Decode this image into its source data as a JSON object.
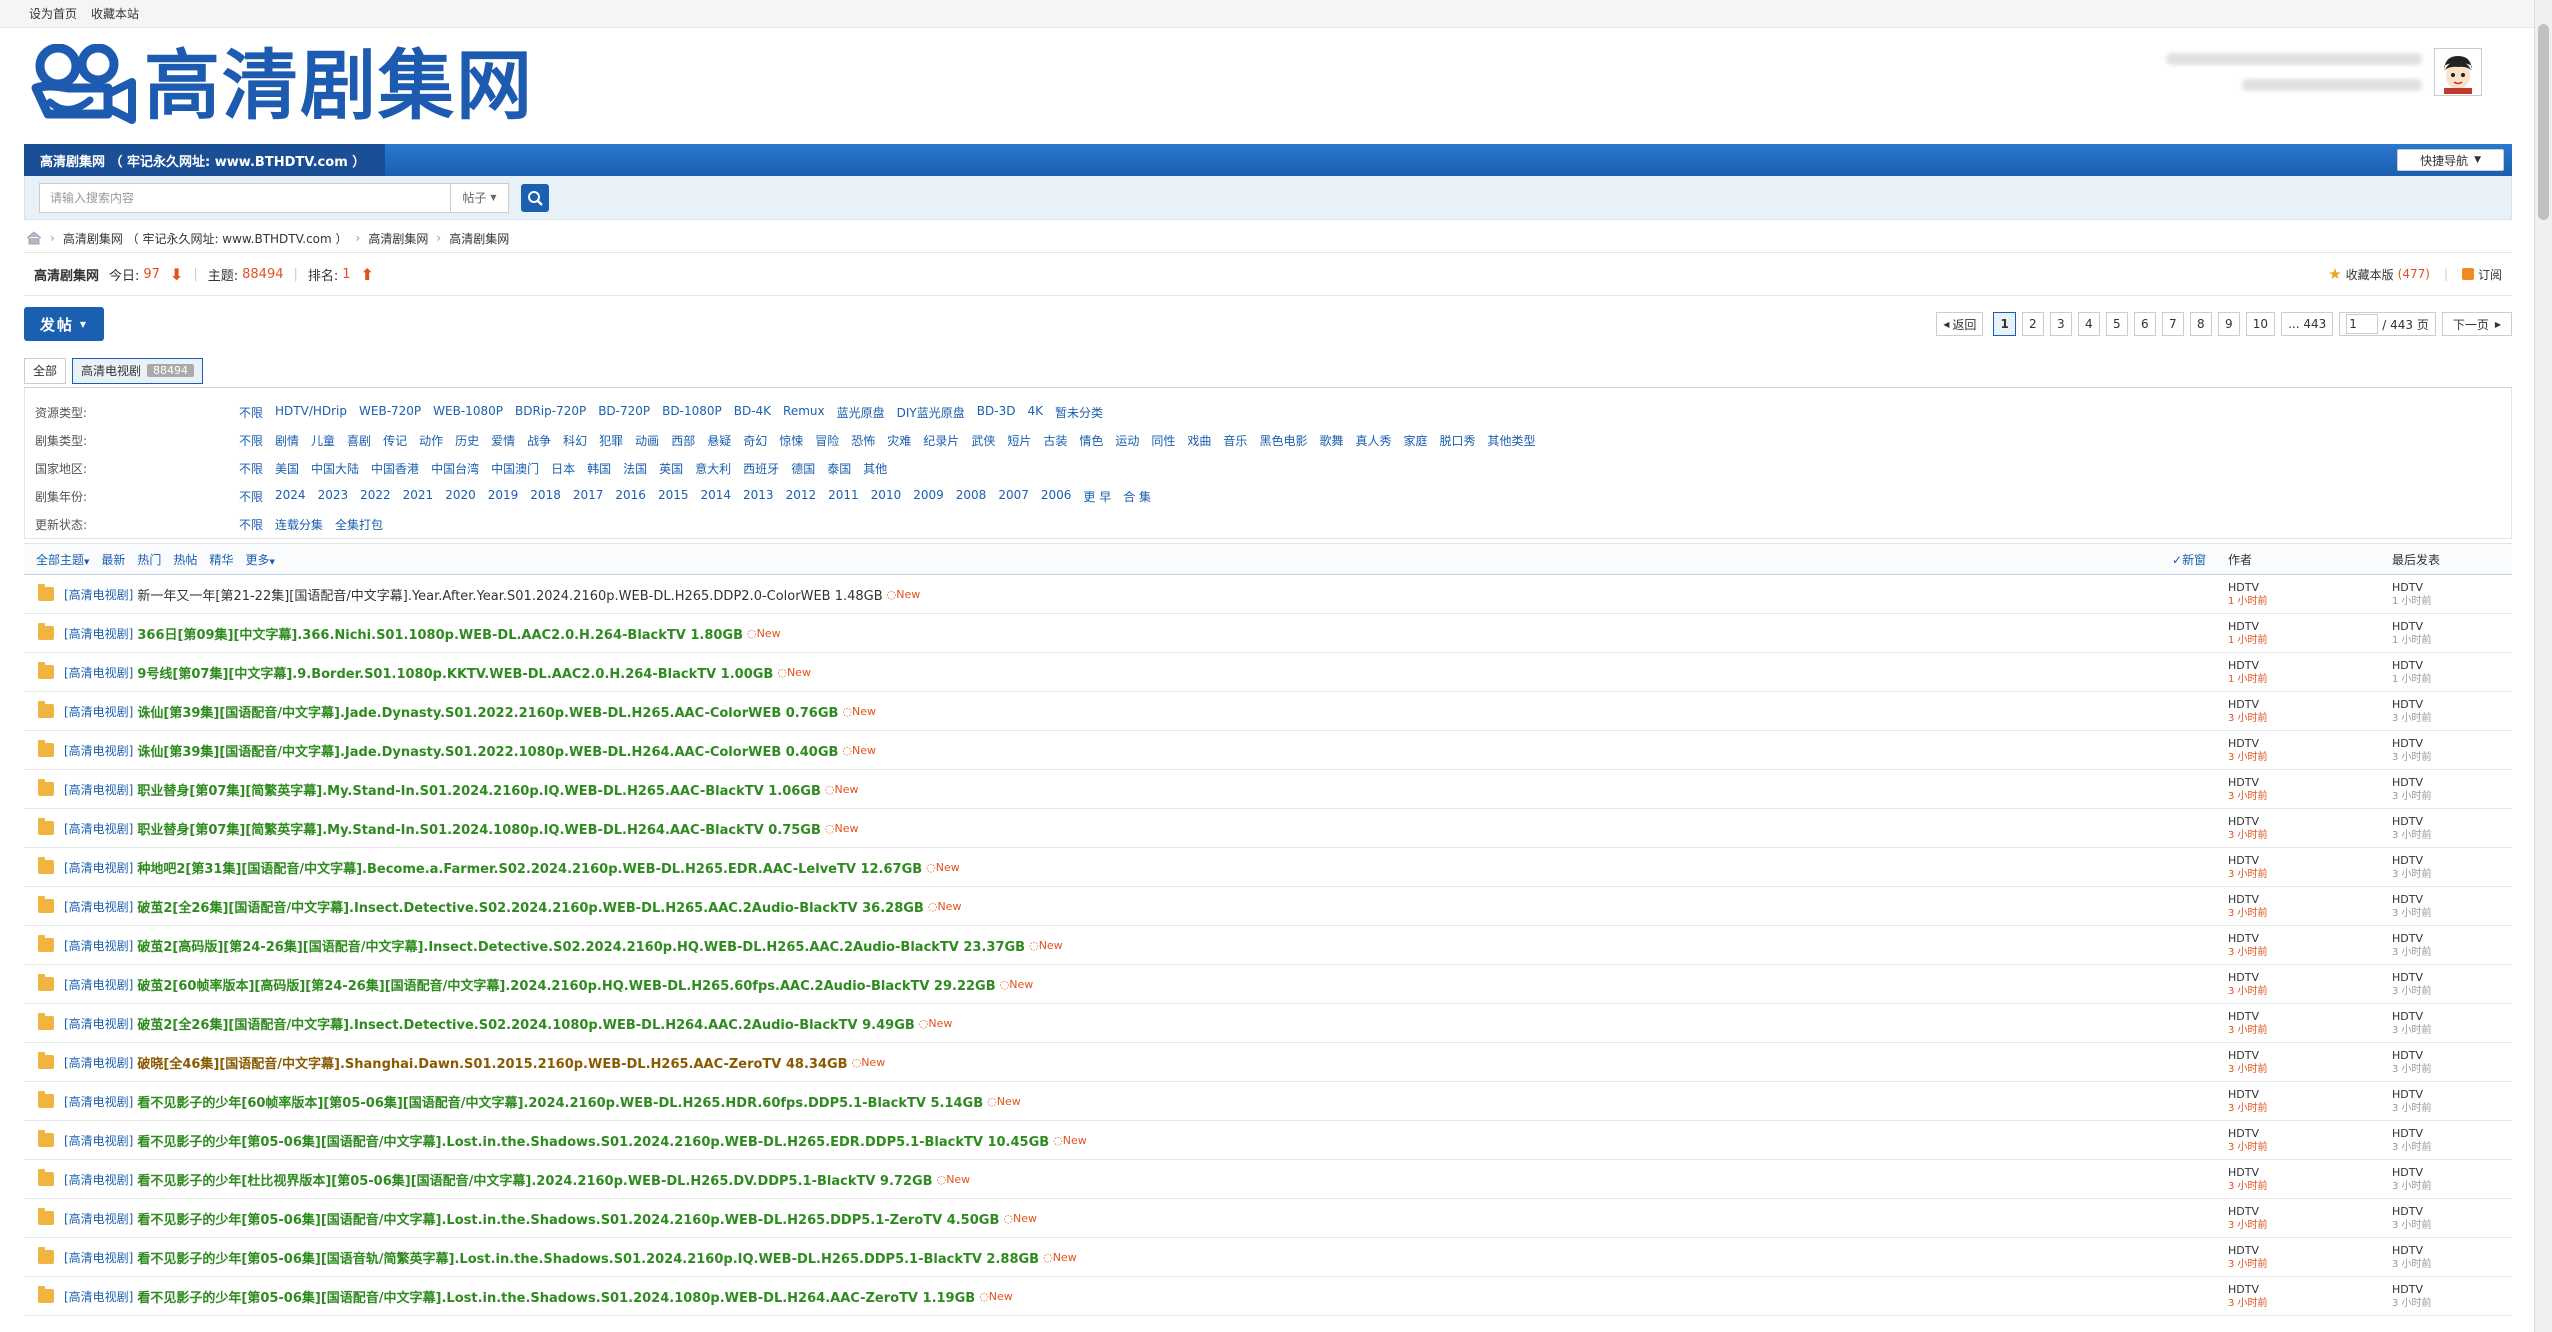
{
  "topbar": {
    "set_home": "设为首页",
    "bookmark": "收藏本站"
  },
  "logo": {
    "text": "高清剧集网"
  },
  "nav": {
    "title": "高清剧集网 （ 牢记永久网址: www.BTHDTV.com ）",
    "quick_nav": "快捷导航"
  },
  "search": {
    "placeholder": "请输入搜索内容",
    "type": "帖子"
  },
  "breadcrumb": {
    "items": [
      "高清剧集网 （ 牢记永久网址: www.BTHDTV.com ）",
      "高清剧集网",
      "高清剧集网"
    ]
  },
  "forum": {
    "name": "高清剧集网",
    "today_label": "今日:",
    "today": "97",
    "topics_label": "主题:",
    "topics": "88494",
    "rank_label": "排名:",
    "rank": "1",
    "favorite": "收藏本版",
    "favorite_count": "(477)",
    "subscribe": "订阅"
  },
  "actions": {
    "post": "发帖"
  },
  "pager": {
    "back": "返回",
    "pages": [
      "1",
      "2",
      "3",
      "4",
      "5",
      "6",
      "7",
      "8",
      "9",
      "10"
    ],
    "last": "... 443",
    "input": "1",
    "total": "/ 443 页",
    "next": "下一页"
  },
  "tabs": {
    "all": "全部",
    "current": "高清电视剧",
    "count": "88494"
  },
  "filters": [
    {
      "label": "资源类型:",
      "options": [
        "不限",
        "HDTV/HDrip",
        "WEB-720P",
        "WEB-1080P",
        "BDRip-720P",
        "BD-720P",
        "BD-1080P",
        "BD-4K",
        "Remux",
        "蓝光原盘",
        "DIY蓝光原盘",
        "BD-3D",
        "4K",
        "暂未分类"
      ]
    },
    {
      "label": "剧集类型:",
      "options": [
        "不限",
        "剧情",
        "儿童",
        "喜剧",
        "传记",
        "动作",
        "历史",
        "爱情",
        "战争",
        "科幻",
        "犯罪",
        "动画",
        "西部",
        "悬疑",
        "奇幻",
        "惊悚",
        "冒险",
        "恐怖",
        "灾难",
        "纪录片",
        "武侠",
        "短片",
        "古装",
        "情色",
        "运动",
        "同性",
        "戏曲",
        "音乐",
        "黑色电影",
        "歌舞",
        "真人秀",
        "家庭",
        "脱口秀",
        "其他类型"
      ]
    },
    {
      "label": "国家地区:",
      "options": [
        "不限",
        "美国",
        "中国大陆",
        "中国香港",
        "中国台湾",
        "中国澳门",
        "日本",
        "韩国",
        "法国",
        "英国",
        "意大利",
        "西班牙",
        "德国",
        "泰国",
        "其他"
      ]
    },
    {
      "label": "剧集年份:",
      "options": [
        "不限",
        "2024",
        "2023",
        "2022",
        "2021",
        "2020",
        "2019",
        "2018",
        "2017",
        "2016",
        "2015",
        "2014",
        "2013",
        "2012",
        "2011",
        "2010",
        "2009",
        "2008",
        "2007",
        "2006",
        "更 早",
        "合 集"
      ]
    },
    {
      "label": "更新状态:",
      "options": [
        "不限",
        "连载分集",
        "全集打包"
      ]
    }
  ],
  "listhead": {
    "all": "全部主题",
    "latest": "最新",
    "hot": "热门",
    "hotpost": "热帖",
    "digest": "精华",
    "more": "更多",
    "new": "新窗",
    "author": "作者",
    "lastpost": "最后发表"
  },
  "threads": [
    {
      "cat": "[高清电视剧]",
      "title": "新一年又一年[第21-22集][国语配音/中文字幕].Year.After.Year.S01.2024.2160p.WEB-DL.H265.DDP2.0-ColorWEB 1.48GB",
      "style": "plain",
      "author": "HDTV",
      "atime": "1 小时前",
      "last": "HDTV",
      "ltime": "1 小时前"
    },
    {
      "cat": "[高清电视剧]",
      "title": "366日[第09集][中文字幕].366.Nichi.S01.1080p.WEB-DL.AAC2.0.H.264-BlackTV 1.80GB",
      "style": "green",
      "author": "HDTV",
      "atime": "1 小时前",
      "last": "HDTV",
      "ltime": "1 小时前"
    },
    {
      "cat": "[高清电视剧]",
      "title": "9号线[第07集][中文字幕].9.Border.S01.1080p.KKTV.WEB-DL.AAC2.0.H.264-BlackTV 1.00GB",
      "style": "green",
      "author": "HDTV",
      "atime": "1 小时前",
      "last": "HDTV",
      "ltime": "1 小时前"
    },
    {
      "cat": "[高清电视剧]",
      "title": "诛仙[第39集][国语配音/中文字幕].Jade.Dynasty.S01.2022.2160p.WEB-DL.H265.AAC-ColorWEB 0.76GB",
      "style": "green",
      "author": "HDTV",
      "atime": "3 小时前",
      "last": "HDTV",
      "ltime": "3 小时前"
    },
    {
      "cat": "[高清电视剧]",
      "title": "诛仙[第39集][国语配音/中文字幕].Jade.Dynasty.S01.2022.1080p.WEB-DL.H264.AAC-ColorWEB 0.40GB",
      "style": "green",
      "author": "HDTV",
      "atime": "3 小时前",
      "last": "HDTV",
      "ltime": "3 小时前"
    },
    {
      "cat": "[高清电视剧]",
      "title": "职业替身[第07集][简繁英字幕].My.Stand-In.S01.2024.2160p.IQ.WEB-DL.H265.AAC-BlackTV 1.06GB",
      "style": "green",
      "author": "HDTV",
      "atime": "3 小时前",
      "last": "HDTV",
      "ltime": "3 小时前"
    },
    {
      "cat": "[高清电视剧]",
      "title": "职业替身[第07集][简繁英字幕].My.Stand-In.S01.2024.1080p.IQ.WEB-DL.H264.AAC-BlackTV 0.75GB",
      "style": "green",
      "author": "HDTV",
      "atime": "3 小时前",
      "last": "HDTV",
      "ltime": "3 小时前"
    },
    {
      "cat": "[高清电视剧]",
      "title": "种地吧2[第31集][国语配音/中文字幕].Become.a.Farmer.S02.2024.2160p.WEB-DL.H265.EDR.AAC-LelveTV 12.67GB",
      "style": "green",
      "author": "HDTV",
      "atime": "3 小时前",
      "last": "HDTV",
      "ltime": "3 小时前"
    },
    {
      "cat": "[高清电视剧]",
      "title": "破茧2[全26集][国语配音/中文字幕].Insect.Detective.S02.2024.2160p.WEB-DL.H265.AAC.2Audio-BlackTV 36.28GB",
      "style": "green",
      "author": "HDTV",
      "atime": "3 小时前",
      "last": "HDTV",
      "ltime": "3 小时前"
    },
    {
      "cat": "[高清电视剧]",
      "title": "破茧2[高码版][第24-26集][国语配音/中文字幕].Insect.Detective.S02.2024.2160p.HQ.WEB-DL.H265.AAC.2Audio-BlackTV 23.37GB",
      "style": "green",
      "author": "HDTV",
      "atime": "3 小时前",
      "last": "HDTV",
      "ltime": "3 小时前"
    },
    {
      "cat": "[高清电视剧]",
      "title": "破茧2[60帧率版本][高码版][第24-26集][国语配音/中文字幕].2024.2160p.HQ.WEB-DL.H265.60fps.AAC.2Audio-BlackTV 29.22GB",
      "style": "green",
      "author": "HDTV",
      "atime": "3 小时前",
      "last": "HDTV",
      "ltime": "3 小时前"
    },
    {
      "cat": "[高清电视剧]",
      "title": "破茧2[全26集][国语配音/中文字幕].Insect.Detective.S02.2024.1080p.WEB-DL.H264.AAC.2Audio-BlackTV 9.49GB",
      "style": "green",
      "author": "HDTV",
      "atime": "3 小时前",
      "last": "HDTV",
      "ltime": "3 小时前"
    },
    {
      "cat": "[高清电视剧]",
      "title": "破晓[全46集][国语配音/中文字幕].Shanghai.Dawn.S01.2015.2160p.WEB-DL.H265.AAC-ZeroTV 48.34GB",
      "style": "brown",
      "author": "HDTV",
      "atime": "3 小时前",
      "last": "HDTV",
      "ltime": "3 小时前"
    },
    {
      "cat": "[高清电视剧]",
      "title": "看不见影子的少年[60帧率版本][第05-06集][国语配音/中文字幕].2024.2160p.WEB-DL.H265.HDR.60fps.DDP5.1-BlackTV 5.14GB",
      "style": "green",
      "author": "HDTV",
      "atime": "3 小时前",
      "last": "HDTV",
      "ltime": "3 小时前"
    },
    {
      "cat": "[高清电视剧]",
      "title": "看不见影子的少年[第05-06集][国语配音/中文字幕].Lost.in.the.Shadows.S01.2024.2160p.WEB-DL.H265.EDR.DDP5.1-BlackTV 10.45GB",
      "style": "green",
      "author": "HDTV",
      "atime": "3 小时前",
      "last": "HDTV",
      "ltime": "3 小时前"
    },
    {
      "cat": "[高清电视剧]",
      "title": "看不见影子的少年[杜比视界版本][第05-06集][国语配音/中文字幕].2024.2160p.WEB-DL.H265.DV.DDP5.1-BlackTV 9.72GB",
      "style": "green",
      "author": "HDTV",
      "atime": "3 小时前",
      "last": "HDTV",
      "ltime": "3 小时前"
    },
    {
      "cat": "[高清电视剧]",
      "title": "看不见影子的少年[第05-06集][国语配音/中文字幕].Lost.in.the.Shadows.S01.2024.2160p.WEB-DL.H265.DDP5.1-ZeroTV 4.50GB",
      "style": "green",
      "author": "HDTV",
      "atime": "3 小时前",
      "last": "HDTV",
      "ltime": "3 小时前"
    },
    {
      "cat": "[高清电视剧]",
      "title": "看不见影子的少年[第05-06集][国语音轨/简繁英字幕].Lost.in.the.Shadows.S01.2024.2160p.IQ.WEB-DL.H265.DDP5.1-BlackTV 2.88GB",
      "style": "green",
      "author": "HDTV",
      "atime": "3 小时前",
      "last": "HDTV",
      "ltime": "3 小时前"
    },
    {
      "cat": "[高清电视剧]",
      "title": "看不见影子的少年[第05-06集][国语配音/中文字幕].Lost.in.the.Shadows.S01.2024.1080p.WEB-DL.H264.AAC-ZeroTV 1.19GB",
      "style": "green",
      "author": "HDTV",
      "atime": "3 小时前",
      "last": "HDTV",
      "ltime": "3 小时前"
    }
  ],
  "new_tag": "New",
  "colors": {
    "brand": "#1a5fb0",
    "title_green": "#2e8b1f",
    "accent_red": "#e0521c"
  }
}
